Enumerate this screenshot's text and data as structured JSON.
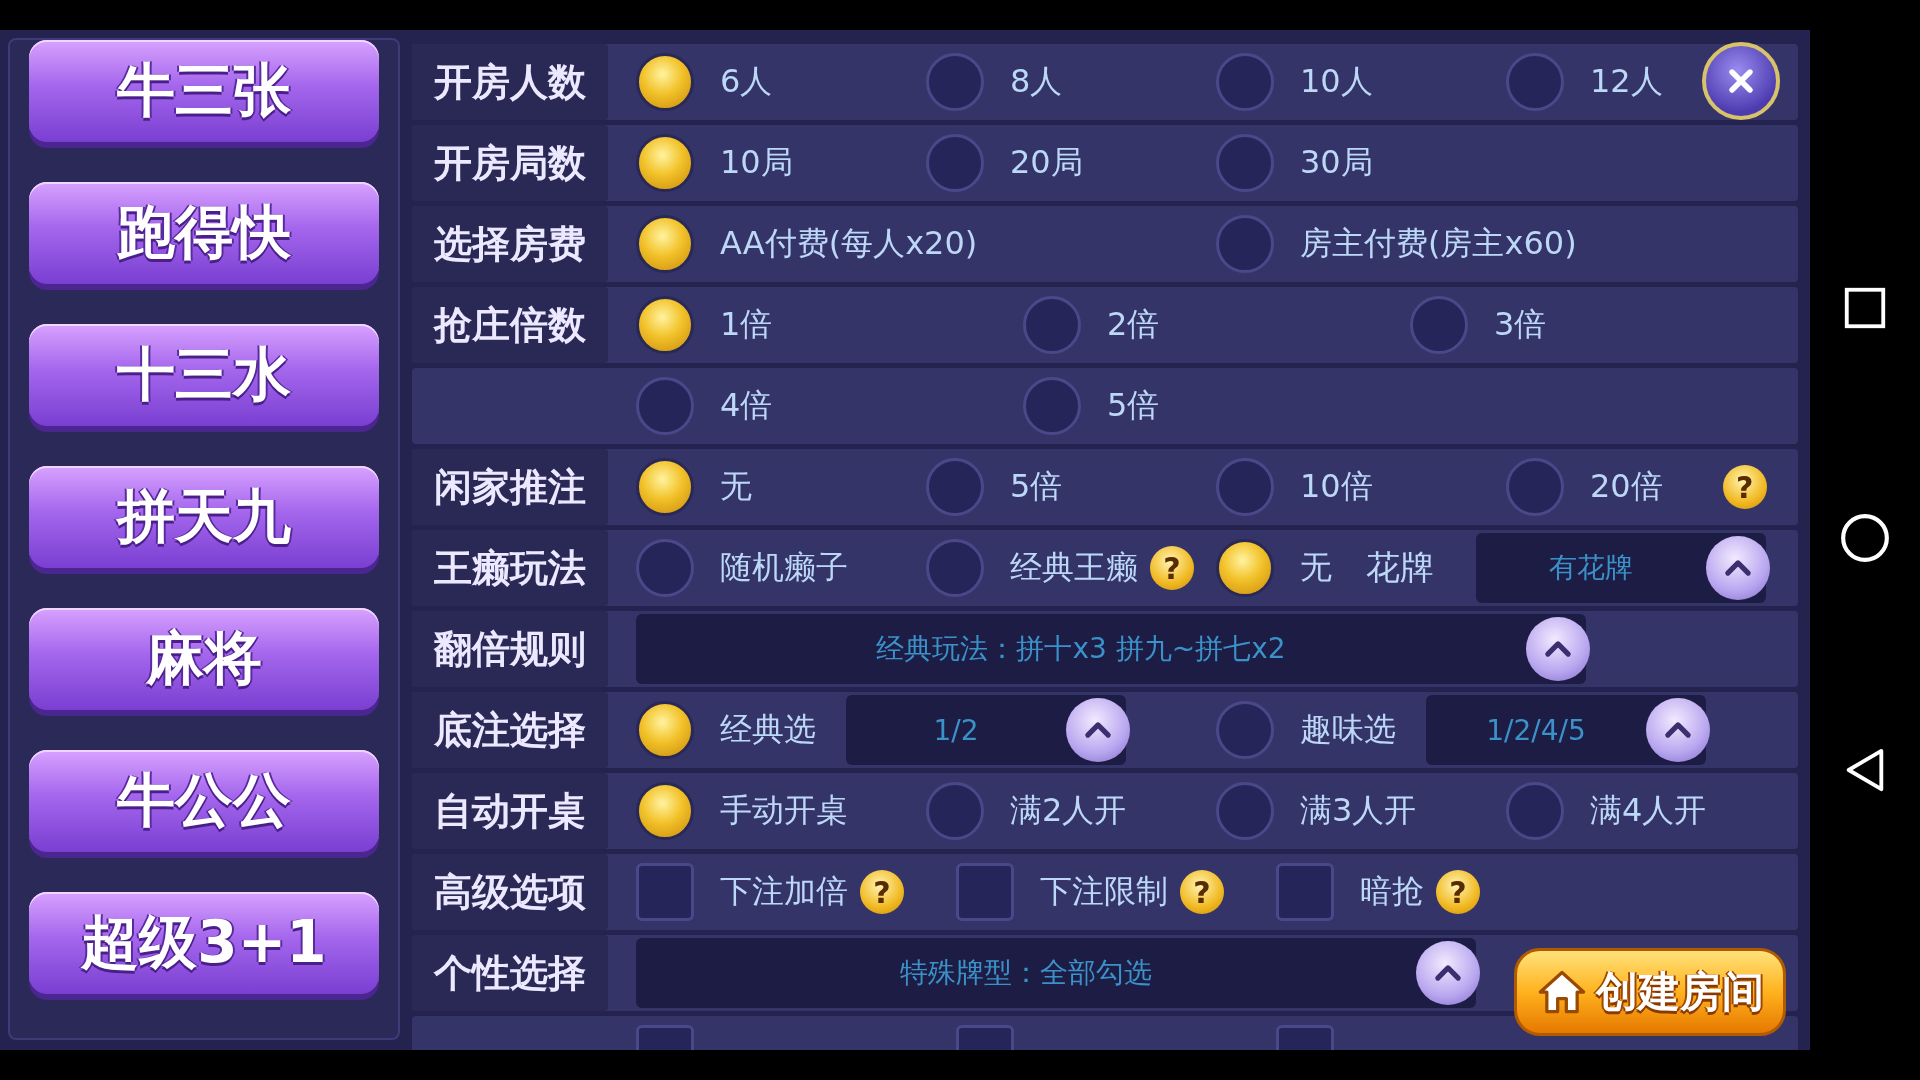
{
  "sidebar": {
    "items": [
      {
        "label": "牛三张"
      },
      {
        "label": "跑得快"
      },
      {
        "label": "十三水"
      },
      {
        "label": "拼天九"
      },
      {
        "label": "麻将"
      },
      {
        "label": "牛公公"
      },
      {
        "label": "超级3+1"
      }
    ]
  },
  "rows": [
    {
      "kind": "radio",
      "label": "开房人数",
      "options": [
        {
          "label": "6人",
          "selected": true
        },
        {
          "label": "8人",
          "selected": false
        },
        {
          "label": "10人",
          "selected": false
        },
        {
          "label": "12人",
          "selected": false
        }
      ]
    },
    {
      "kind": "radio",
      "label": "开房局数",
      "options": [
        {
          "label": "10局",
          "selected": true
        },
        {
          "label": "20局",
          "selected": false
        },
        {
          "label": "30局",
          "selected": false
        }
      ]
    },
    {
      "kind": "radio_pair",
      "label": "选择房费",
      "options": [
        {
          "label": "AA付费(每人x20)",
          "selected": true
        },
        {
          "label": "房主付费(房主x60)",
          "selected": false
        }
      ]
    },
    {
      "kind": "radio_wide",
      "label": "抢庄倍数",
      "options": [
        {
          "label": "1倍",
          "selected": true
        },
        {
          "label": "2倍",
          "selected": false
        },
        {
          "label": "3倍",
          "selected": false
        }
      ]
    },
    {
      "kind": "radio_wide",
      "options": [
        {
          "label": "4倍",
          "selected": false
        },
        {
          "label": "5倍",
          "selected": false
        }
      ]
    },
    {
      "kind": "radio",
      "label": "闲家推注",
      "options": [
        {
          "label": "无",
          "selected": true
        },
        {
          "label": "5倍",
          "selected": false
        },
        {
          "label": "10倍",
          "selected": false
        },
        {
          "label": "20倍",
          "selected": false,
          "hint": "?"
        }
      ]
    },
    {
      "kind": "radio_extra",
      "label": "王癞玩法",
      "options": [
        {
          "label": "随机癞子",
          "selected": false
        },
        {
          "label": "经典王癞",
          "selected": false,
          "hint": "?"
        },
        {
          "label": "无",
          "selected": true
        }
      ],
      "extra_label": "花牌",
      "dropdown": "有花牌"
    },
    {
      "kind": "dropdown",
      "label": "翻倍规则",
      "dropdown": "经典玩法：拼十x3 拼九~拼七x2"
    },
    {
      "kind": "radio_dropdown",
      "label": "底注选择",
      "options": [
        {
          "label": "经典选",
          "selected": true,
          "dropdown": "1/2"
        },
        {
          "label": "趣味选",
          "selected": false,
          "dropdown": "1/2/4/5"
        }
      ]
    },
    {
      "kind": "radio",
      "label": "自动开桌",
      "options": [
        {
          "label": "手动开桌",
          "selected": true
        },
        {
          "label": "满2人开",
          "selected": false
        },
        {
          "label": "满3人开",
          "selected": false
        },
        {
          "label": "满4人开",
          "selected": false
        }
      ]
    },
    {
      "kind": "checkbox",
      "label": "高级选项",
      "options": [
        {
          "label": "下注加倍",
          "checked": false,
          "hint": "?"
        },
        {
          "label": "下注限制",
          "checked": false,
          "hint": "?"
        },
        {
          "label": "暗抢",
          "checked": false,
          "hint": "?"
        }
      ]
    },
    {
      "kind": "dropdown",
      "label": "个性选择",
      "dropdown": "特殊牌型：全部勾选"
    },
    {
      "kind": "checkbox",
      "options": [
        {
          "checked": false
        },
        {
          "checked": false
        },
        {
          "checked": false
        }
      ]
    }
  ],
  "create_button": {
    "label": "创建房间"
  }
}
